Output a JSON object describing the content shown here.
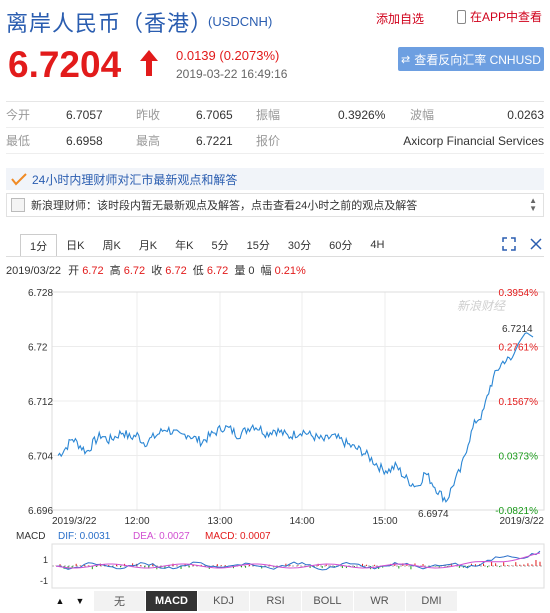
{
  "header": {
    "title": "离岸人民币（香港）",
    "code": "(USDCNH)",
    "add_favorite": "添加自选",
    "app_link": "在APP中查看"
  },
  "quote": {
    "price": "6.7204",
    "change": "0.0139 (0.2073%)",
    "time": "2019-03-22 16:49:16",
    "reverse_button": "查看反向汇率 CNHUSD"
  },
  "stats": {
    "open_label": "今开",
    "open_value": "6.7057",
    "prev_close_label": "昨收",
    "prev_close_value": "6.7065",
    "amplitude_label": "振幅",
    "amplitude_value": "0.3926%",
    "wave_label": "波幅",
    "wave_value": "0.0263",
    "low_label": "最低",
    "low_value": "6.6958",
    "high_label": "最高",
    "high_value": "6.7221",
    "quote_label": "报价",
    "quote_value": "Axicorp Financial Services"
  },
  "news": {
    "banner": "24小时内理财师对汇市最新观点和解答",
    "item": "新浪理财师：该时段内暂无最新观点及解答，点击查看24小时之前的观点及解答"
  },
  "tabs": [
    "1分",
    "日K",
    "周K",
    "月K",
    "年K",
    "5分",
    "15分",
    "30分",
    "60分",
    "4H"
  ],
  "info_line": {
    "date": "2019/03/22",
    "open_label": "开",
    "open": "6.72",
    "high_label": "高",
    "high": "6.72",
    "close_label": "收",
    "close": "6.72",
    "low_label": "低",
    "low": "6.72",
    "volume_label": "量",
    "volume": "0",
    "range_label": "幅",
    "range": "0.21%"
  },
  "chart_data": {
    "type": "line",
    "watermark": "新浪财经",
    "y_ticks": [
      "6.728",
      "6.72",
      "6.712",
      "6.704",
      "6.696"
    ],
    "y_range": [
      6.696,
      6.728
    ],
    "right_ticks": [
      "0.3954%",
      "0.2761%",
      "0.1567%",
      "0.0373%",
      "-0.0821%"
    ],
    "x_ticks": [
      "2019/3/22",
      "12:00",
      "13:00",
      "14:00",
      "15:00",
      "2019/3/22"
    ],
    "last_price_label": "6.7214",
    "low_label": "6.6974",
    "series": [
      {
        "values": [
          6.704,
          6.705,
          6.7065,
          6.7055,
          6.7045,
          6.706,
          6.707,
          6.7062,
          6.7068,
          6.7075,
          6.7066,
          6.707,
          6.7058,
          6.7065,
          6.7072,
          6.708,
          6.7074,
          6.7068,
          6.7072,
          6.7065,
          6.706,
          6.7068,
          6.7075,
          6.7082,
          6.7078,
          6.707,
          6.7076,
          6.7085,
          6.708,
          6.7072,
          6.7078,
          6.7074,
          6.7068,
          6.7072,
          6.7076,
          6.707,
          6.7066,
          6.7062,
          6.7068,
          6.7064,
          6.7058,
          6.7052,
          6.7048,
          6.704,
          6.703,
          6.702,
          6.7018,
          6.7025,
          6.701,
          6.7,
          6.6995,
          6.7015,
          6.7,
          6.6985,
          6.6974,
          6.7,
          6.702,
          6.706,
          6.709,
          6.71,
          6.714,
          6.7165,
          6.718,
          6.718,
          6.7205,
          6.7221,
          6.7214
        ]
      }
    ]
  },
  "macd": {
    "label": "MACD",
    "dif": "DIF: 0.0031",
    "dea": "DEA: 0.0027",
    "macd": "MACD: 0.0007",
    "y_ticks": [
      "1",
      "-1"
    ],
    "dif_color": "#2a6fc9",
    "dea_color": "#d14fd1",
    "macd_color": "#e21b1b"
  },
  "bottom_tabs": [
    "无",
    "MACD",
    "KDJ",
    "RSI",
    "BOLL",
    "WR",
    "DMI"
  ],
  "bottom_active": "MACD"
}
